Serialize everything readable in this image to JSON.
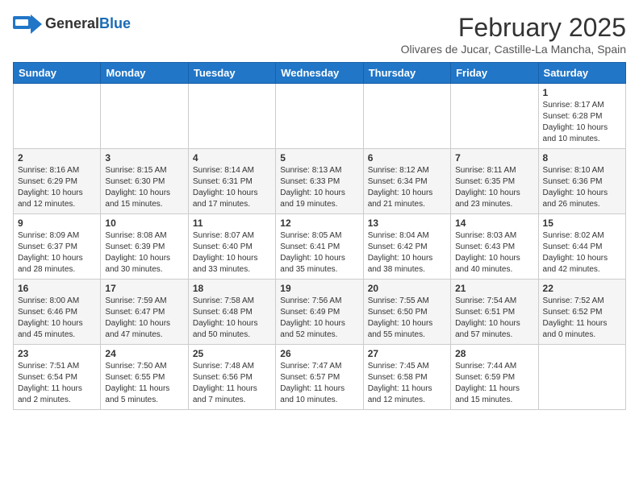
{
  "header": {
    "logo_general": "General",
    "logo_blue": "Blue",
    "month_title": "February 2025",
    "location": "Olivares de Jucar, Castille-La Mancha, Spain"
  },
  "weekdays": [
    "Sunday",
    "Monday",
    "Tuesday",
    "Wednesday",
    "Thursday",
    "Friday",
    "Saturday"
  ],
  "weeks": [
    [
      {
        "day": "",
        "info": ""
      },
      {
        "day": "",
        "info": ""
      },
      {
        "day": "",
        "info": ""
      },
      {
        "day": "",
        "info": ""
      },
      {
        "day": "",
        "info": ""
      },
      {
        "day": "",
        "info": ""
      },
      {
        "day": "1",
        "info": "Sunrise: 8:17 AM\nSunset: 6:28 PM\nDaylight: 10 hours\nand 10 minutes."
      }
    ],
    [
      {
        "day": "2",
        "info": "Sunrise: 8:16 AM\nSunset: 6:29 PM\nDaylight: 10 hours\nand 12 minutes."
      },
      {
        "day": "3",
        "info": "Sunrise: 8:15 AM\nSunset: 6:30 PM\nDaylight: 10 hours\nand 15 minutes."
      },
      {
        "day": "4",
        "info": "Sunrise: 8:14 AM\nSunset: 6:31 PM\nDaylight: 10 hours\nand 17 minutes."
      },
      {
        "day": "5",
        "info": "Sunrise: 8:13 AM\nSunset: 6:33 PM\nDaylight: 10 hours\nand 19 minutes."
      },
      {
        "day": "6",
        "info": "Sunrise: 8:12 AM\nSunset: 6:34 PM\nDaylight: 10 hours\nand 21 minutes."
      },
      {
        "day": "7",
        "info": "Sunrise: 8:11 AM\nSunset: 6:35 PM\nDaylight: 10 hours\nand 23 minutes."
      },
      {
        "day": "8",
        "info": "Sunrise: 8:10 AM\nSunset: 6:36 PM\nDaylight: 10 hours\nand 26 minutes."
      }
    ],
    [
      {
        "day": "9",
        "info": "Sunrise: 8:09 AM\nSunset: 6:37 PM\nDaylight: 10 hours\nand 28 minutes."
      },
      {
        "day": "10",
        "info": "Sunrise: 8:08 AM\nSunset: 6:39 PM\nDaylight: 10 hours\nand 30 minutes."
      },
      {
        "day": "11",
        "info": "Sunrise: 8:07 AM\nSunset: 6:40 PM\nDaylight: 10 hours\nand 33 minutes."
      },
      {
        "day": "12",
        "info": "Sunrise: 8:05 AM\nSunset: 6:41 PM\nDaylight: 10 hours\nand 35 minutes."
      },
      {
        "day": "13",
        "info": "Sunrise: 8:04 AM\nSunset: 6:42 PM\nDaylight: 10 hours\nand 38 minutes."
      },
      {
        "day": "14",
        "info": "Sunrise: 8:03 AM\nSunset: 6:43 PM\nDaylight: 10 hours\nand 40 minutes."
      },
      {
        "day": "15",
        "info": "Sunrise: 8:02 AM\nSunset: 6:44 PM\nDaylight: 10 hours\nand 42 minutes."
      }
    ],
    [
      {
        "day": "16",
        "info": "Sunrise: 8:00 AM\nSunset: 6:46 PM\nDaylight: 10 hours\nand 45 minutes."
      },
      {
        "day": "17",
        "info": "Sunrise: 7:59 AM\nSunset: 6:47 PM\nDaylight: 10 hours\nand 47 minutes."
      },
      {
        "day": "18",
        "info": "Sunrise: 7:58 AM\nSunset: 6:48 PM\nDaylight: 10 hours\nand 50 minutes."
      },
      {
        "day": "19",
        "info": "Sunrise: 7:56 AM\nSunset: 6:49 PM\nDaylight: 10 hours\nand 52 minutes."
      },
      {
        "day": "20",
        "info": "Sunrise: 7:55 AM\nSunset: 6:50 PM\nDaylight: 10 hours\nand 55 minutes."
      },
      {
        "day": "21",
        "info": "Sunrise: 7:54 AM\nSunset: 6:51 PM\nDaylight: 10 hours\nand 57 minutes."
      },
      {
        "day": "22",
        "info": "Sunrise: 7:52 AM\nSunset: 6:52 PM\nDaylight: 11 hours\nand 0 minutes."
      }
    ],
    [
      {
        "day": "23",
        "info": "Sunrise: 7:51 AM\nSunset: 6:54 PM\nDaylight: 11 hours\nand 2 minutes."
      },
      {
        "day": "24",
        "info": "Sunrise: 7:50 AM\nSunset: 6:55 PM\nDaylight: 11 hours\nand 5 minutes."
      },
      {
        "day": "25",
        "info": "Sunrise: 7:48 AM\nSunset: 6:56 PM\nDaylight: 11 hours\nand 7 minutes."
      },
      {
        "day": "26",
        "info": "Sunrise: 7:47 AM\nSunset: 6:57 PM\nDaylight: 11 hours\nand 10 minutes."
      },
      {
        "day": "27",
        "info": "Sunrise: 7:45 AM\nSunset: 6:58 PM\nDaylight: 11 hours\nand 12 minutes."
      },
      {
        "day": "28",
        "info": "Sunrise: 7:44 AM\nSunset: 6:59 PM\nDaylight: 11 hours\nand 15 minutes."
      },
      {
        "day": "",
        "info": ""
      }
    ]
  ]
}
